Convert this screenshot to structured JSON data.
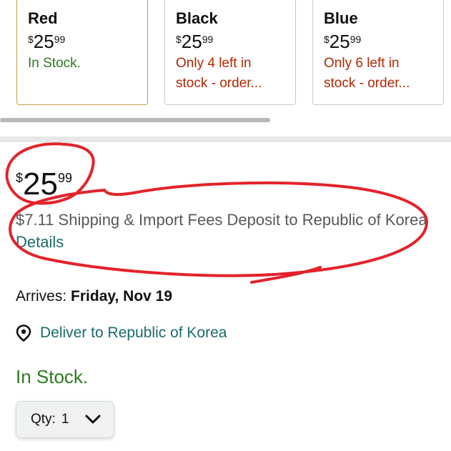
{
  "variants": [
    {
      "name": "Red",
      "price_symbol": "$",
      "price_whole": "25",
      "price_fraction": "99",
      "stock_line1": "In Stock.",
      "stock_line2": ""
    },
    {
      "name": "Black",
      "price_symbol": "$",
      "price_whole": "25",
      "price_fraction": "99",
      "stock_line1": "Only 4 left in",
      "stock_line2": "stock - order..."
    },
    {
      "name": "Blue",
      "price_symbol": "$",
      "price_whole": "25",
      "price_fraction": "99",
      "stock_line1": "Only 6 left in",
      "stock_line2": "stock - order..."
    }
  ],
  "price": {
    "symbol": "$",
    "whole": "25",
    "fraction": "99"
  },
  "shipping": {
    "text": "$7.11 Shipping & Import Fees Deposit to Republic of Korea",
    "details_link": "Details"
  },
  "delivery": {
    "label": "Arrives:",
    "date": "Friday, Nov 19"
  },
  "deliver_to": {
    "text": "Deliver to Republic of Korea",
    "icon": "location-pin-icon"
  },
  "availability": "In Stock.",
  "quantity": {
    "label": "Qty:",
    "value": "1"
  },
  "colors": {
    "in_stock": "#2c7a1f",
    "low_stock": "#b12704",
    "link": "#1a6b6b",
    "annotation": "#e3232c",
    "selected_border": "#c59a4a"
  }
}
